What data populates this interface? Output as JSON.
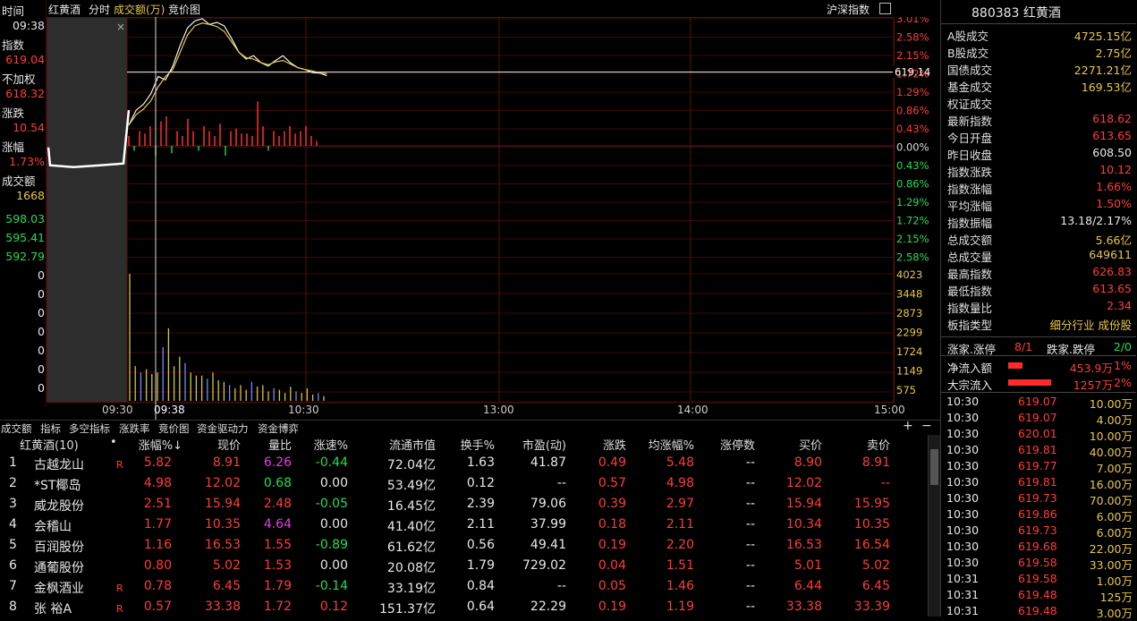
{
  "top": {
    "time_label": "时间",
    "stock_name": "红黄酒",
    "tab_intraday": "分时",
    "tab_volume": "成交额(万)",
    "tab_auction": "竞价图",
    "index_ref": "沪深指数",
    "close_x": "×"
  },
  "left": {
    "time_value": "09:38",
    "index_label": "指数",
    "index_value": "619.04",
    "unweighted_label": "不加权",
    "unweighted_value": "618.32",
    "change_label": "涨跌",
    "change_value": "10.54",
    "change_pct_label": "涨幅",
    "change_pct_value": "1.73%",
    "turnover_label": "成交额",
    "turnover_value": "1668",
    "scale_values": [
      "598.03",
      "595.41",
      "592.79",
      "0",
      "0",
      "0",
      "0",
      "0",
      "0",
      "0"
    ]
  },
  "pct_axis": [
    "3.01%",
    "2.58%",
    "2.15%",
    "1.72%",
    "1.29%",
    "0.86%",
    "0.43%",
    "0.00%",
    "0.43%",
    "0.86%",
    "1.29%",
    "1.72%",
    "2.15%",
    "2.58%"
  ],
  "vol_axis": [
    "4023",
    "3448",
    "2873",
    "2299",
    "1724",
    "1149",
    "575"
  ],
  "price_marker": "619.14",
  "time_axis": [
    "09:30",
    "09:38",
    "10:30",
    "13:00",
    "14:00",
    "15:00"
  ],
  "right": {
    "title": "880383 红黄酒",
    "rows": [
      {
        "k": "A股成交",
        "v": "4725.15亿",
        "c": "yellow"
      },
      {
        "k": "B股成交",
        "v": "2.75亿",
        "c": "yellow"
      },
      {
        "k": "国债成交",
        "v": "2271.21亿",
        "c": "yellow"
      },
      {
        "k": "基金成交",
        "v": "169.53亿",
        "c": "yellow"
      },
      {
        "k": "权证成交",
        "v": "",
        "c": "yellow"
      },
      {
        "k": "最新指数",
        "v": "618.62",
        "c": "red"
      },
      {
        "k": "今日开盘",
        "v": "613.65",
        "c": "red"
      },
      {
        "k": "昨日收盘",
        "v": "608.50",
        "c": "white"
      },
      {
        "k": "指数涨跌",
        "v": "10.12",
        "c": "red"
      },
      {
        "k": "指数涨幅",
        "v": "1.66%",
        "c": "red"
      },
      {
        "k": "平均涨幅",
        "v": "1.50%",
        "c": "red"
      },
      {
        "k": "指数振幅",
        "v": "13.18/2.17%",
        "c": "white"
      },
      {
        "k": "总成交额",
        "v": "5.66亿",
        "c": "yellow"
      },
      {
        "k": "总成交量",
        "v": "649611",
        "c": "yellow"
      },
      {
        "k": "最高指数",
        "v": "626.83",
        "c": "red"
      },
      {
        "k": "最低指数",
        "v": "613.65",
        "c": "red"
      },
      {
        "k": "指数量比",
        "v": "2.34",
        "c": "red"
      },
      {
        "k": "板指类型",
        "v": "细分行业 成份股",
        "c": "yellow"
      }
    ],
    "up_label": "涨家.涨停",
    "up_value": "8/1",
    "down_label": "跌家.跌停",
    "down_value": "2/0",
    "netflow_label": "净流入额",
    "netflow_value": "453.9万",
    "netflow_pct": "1%",
    "netflow_fill": 0.2,
    "block_label": "大宗流入",
    "block_value": "1257万",
    "block_pct": "2%",
    "block_fill": 0.6,
    "ticks": [
      [
        "10:30",
        "619.07",
        "10.00万"
      ],
      [
        "10:30",
        "619.07",
        "4.00万"
      ],
      [
        "10:30",
        "620.01",
        "10.00万"
      ],
      [
        "10:30",
        "619.81",
        "40.00万"
      ],
      [
        "10:30",
        "619.77",
        "7.00万"
      ],
      [
        "10:30",
        "619.81",
        "16.00万"
      ],
      [
        "10:30",
        "619.73",
        "70.00万"
      ],
      [
        "10:30",
        "619.86",
        "6.00万"
      ],
      [
        "10:30",
        "619.73",
        "6.00万"
      ],
      [
        "10:30",
        "619.68",
        "22.00万"
      ],
      [
        "10:30",
        "619.58",
        "33.00万"
      ],
      [
        "10:31",
        "619.58",
        "1.00万"
      ],
      [
        "10:31",
        "619.48",
        "125万"
      ],
      [
        "10:31",
        "619.48",
        "3.00万"
      ]
    ]
  },
  "bottom_tabs": [
    "成交额",
    "指标",
    "多空指标",
    "涨跌率",
    "竞价图",
    "资金驱动力",
    "资金博弈"
  ],
  "plus": "+",
  "minus": "−",
  "table": {
    "headers": [
      "红黄酒(10)",
      "•",
      "涨幅%↓",
      "现价",
      "量比",
      "涨速%",
      "流通市值",
      "换手%",
      "市盈(动)",
      "涨跌",
      "均涨幅%",
      "涨停数",
      "买价",
      "卖价"
    ],
    "rows": [
      {
        "n": "1",
        "name": "古越龙山",
        "r": "R",
        "pct": "5.82",
        "price": "8.91",
        "vr": "6.26",
        "vrc": "purple",
        "spd": "-0.44",
        "spdc": "green",
        "mcap": "72.04亿",
        "turn": "1.63",
        "pe": "41.87",
        "chg": "0.49",
        "avg": "5.48",
        "lim": "--",
        "bid": "8.90",
        "ask": "8.91"
      },
      {
        "n": "2",
        "name": "*ST椰岛",
        "r": "",
        "pct": "4.98",
        "price": "12.02",
        "vr": "0.68",
        "vrc": "green",
        "spd": "0.00",
        "spdc": "white",
        "mcap": "53.49亿",
        "turn": "0.12",
        "pe": "--",
        "chg": "0.57",
        "avg": "4.98",
        "lim": "--",
        "bid": "12.02",
        "ask": "--"
      },
      {
        "n": "3",
        "name": "威龙股份",
        "r": "",
        "pct": "2.51",
        "price": "15.94",
        "vr": "2.48",
        "vrc": "red",
        "spd": "-0.05",
        "spdc": "green",
        "mcap": "16.45亿",
        "turn": "2.39",
        "pe": "79.06",
        "chg": "0.39",
        "avg": "2.97",
        "lim": "--",
        "bid": "15.94",
        "ask": "15.95"
      },
      {
        "n": "4",
        "name": "会稽山",
        "r": "",
        "pct": "1.77",
        "price": "10.35",
        "vr": "4.64",
        "vrc": "purple",
        "spd": "0.00",
        "spdc": "white",
        "mcap": "41.40亿",
        "turn": "2.11",
        "pe": "37.99",
        "chg": "0.18",
        "avg": "2.11",
        "lim": "--",
        "bid": "10.34",
        "ask": "10.35"
      },
      {
        "n": "5",
        "name": "百润股份",
        "r": "",
        "pct": "1.16",
        "price": "16.53",
        "vr": "1.55",
        "vrc": "red",
        "spd": "-0.89",
        "spdc": "green",
        "mcap": "61.62亿",
        "turn": "0.56",
        "pe": "49.41",
        "chg": "0.19",
        "avg": "2.20",
        "lim": "--",
        "bid": "16.53",
        "ask": "16.54"
      },
      {
        "n": "6",
        "name": "通葡股份",
        "r": "",
        "pct": "0.80",
        "price": "5.02",
        "vr": "1.53",
        "vrc": "red",
        "spd": "0.00",
        "spdc": "white",
        "mcap": "20.08亿",
        "turn": "1.79",
        "pe": "729.02",
        "chg": "0.04",
        "avg": "1.51",
        "lim": "--",
        "bid": "5.01",
        "ask": "5.02"
      },
      {
        "n": "7",
        "name": "金枫酒业",
        "r": "R",
        "pct": "0.78",
        "price": "6.45",
        "vr": "1.79",
        "vrc": "red",
        "spd": "-0.14",
        "spdc": "green",
        "mcap": "33.19亿",
        "turn": "0.84",
        "pe": "--",
        "chg": "0.05",
        "avg": "1.46",
        "lim": "--",
        "bid": "6.44",
        "ask": "6.45"
      },
      {
        "n": "8",
        "name": "张 裕A",
        "r": "R",
        "pct": "0.57",
        "price": "33.38",
        "vr": "1.72",
        "vrc": "red",
        "spd": "0.12",
        "spdc": "red",
        "mcap": "151.37亿",
        "turn": "0.64",
        "pe": "22.29",
        "chg": "0.19",
        "avg": "1.19",
        "lim": "--",
        "bid": "33.38",
        "ask": "33.39"
      }
    ]
  },
  "chart_data": {
    "type": "line",
    "index_series": [
      611.5,
      613.65,
      614.5,
      616.0,
      618.5,
      618.0,
      620.0,
      623.0,
      625.5,
      626.5,
      626.83,
      626.0,
      626.3,
      625.8,
      624.0,
      622.0,
      621.0,
      621.5,
      620.5,
      620.0,
      620.8,
      621.5,
      620.5,
      619.8,
      619.5,
      619.07,
      619.0,
      618.62
    ],
    "avg_series": [
      611.5,
      613.0,
      613.8,
      615.0,
      617.0,
      618.5,
      619.5,
      622.0,
      624.5,
      625.8,
      626.2,
      626.0,
      625.7,
      625.0,
      623.5,
      622.0,
      621.2,
      621.0,
      620.5,
      620.2,
      620.6,
      620.8,
      620.3,
      619.8,
      619.5,
      619.3,
      619.0,
      618.9
    ],
    "prev_close": 608.5,
    "pct_range": [
      -3.01,
      3.01
    ],
    "volume_bars": [
      4023,
      1100,
      900,
      1000,
      850,
      900,
      1700,
      2300,
      1100,
      1400,
      1200,
      900,
      800,
      800,
      700,
      900,
      650,
      600,
      500,
      400,
      500,
      350,
      600,
      450,
      500,
      300,
      400,
      350,
      250,
      450,
      300,
      250,
      400,
      200,
      250,
      150
    ],
    "buy_sell_bars": [
      0.2,
      -0.1,
      0.3,
      0.25,
      0.4,
      -0.2,
      0.5,
      0.6,
      -0.15,
      0.3,
      0.2,
      0.55,
      0.3,
      -0.1,
      0.4,
      0.3,
      0.2,
      0.45,
      -0.2,
      0.3,
      0.35,
      0.25,
      0.25,
      0.2,
      0.9,
      0.4,
      -0.1,
      0.3,
      0.2,
      0.3,
      0.4,
      0.25,
      0.3,
      0.4,
      0.2,
      0.1
    ],
    "time_labels": [
      "09:30",
      "09:38",
      "10:30",
      "13:00",
      "14:00",
      "15:00"
    ]
  }
}
